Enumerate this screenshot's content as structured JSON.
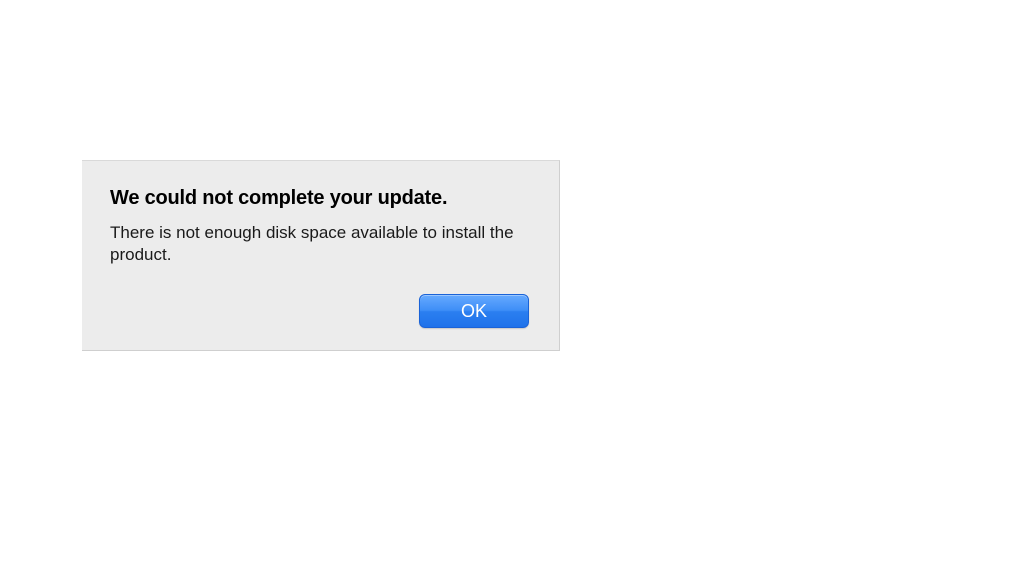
{
  "dialog": {
    "title": "We could not complete your update.",
    "message": "There is not enough disk space available to install the product.",
    "ok_label": "OK"
  }
}
